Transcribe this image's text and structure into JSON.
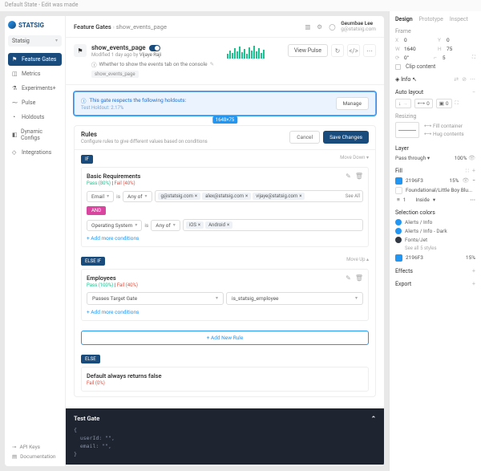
{
  "topBar": "Default State - Edit was made",
  "logo": "STATSIG",
  "workspace": {
    "name": "Statsig"
  },
  "nav": [
    {
      "label": "Feature Gates",
      "active": true
    },
    {
      "label": "Metrics"
    },
    {
      "label": "Experiments+"
    },
    {
      "label": "Pulse"
    },
    {
      "label": "Holdouts"
    },
    {
      "label": "Dynamic Configs"
    },
    {
      "label": "Integrations"
    }
  ],
  "sidebarFooter": {
    "apiKeys": "API Keys",
    "docs": "Documentation"
  },
  "breadcrumb": {
    "root": "Feature Gates",
    "current": "show_events_page"
  },
  "user": {
    "name": "Geumbae Lee",
    "email": "g@statsig.com"
  },
  "page": {
    "title": "show_events_page",
    "modified": "Modified 1 day ago by ",
    "modifiedBy": "Vijaye Raji",
    "desc": "Whether to show the events tab on the console",
    "tag": "show_events_page",
    "viewPulse": "View Pulse"
  },
  "banner": {
    "text": "This gate respects the following holdouts:",
    "sub": "Test Holdout: 2.17%",
    "manage": "Manage",
    "dim": "1648×75"
  },
  "rules": {
    "title": "Rules",
    "sub": "Configure rules to give different values based on conditions",
    "cancel": "Cancel",
    "save": "Save Changes",
    "if": "IF",
    "elseif": "ELSE IF",
    "else": "ELSE",
    "moveDown": "Move Down ▾",
    "moveUp": "Move Up ▴",
    "addCond": "+  Add more conditions",
    "addRule": "+   Add New Rule",
    "rule1": {
      "name": "Basic Requirements",
      "pass": "Pass (80%)",
      "sep": " | ",
      "fail": "Fail (40%)",
      "f1": "Email",
      "op": "Any of",
      "vals": [
        "g@statsig.com",
        "alex@statsig.com",
        "vijaye@statsig.com"
      ],
      "seeAll": "See All",
      "and": "AND",
      "f2": "Operating System",
      "vals2": [
        "iOS",
        "Android"
      ]
    },
    "rule2": {
      "name": "Employees",
      "pass": "Pass (100%)",
      "fail": "Fail (40%)",
      "c1": "Passes Target Gate",
      "c2": "is_statsig_employee"
    },
    "default": {
      "label": "Default always returns false",
      "sub": "Fail (0%)"
    }
  },
  "testGate": {
    "title": "Test Gate",
    "code": "{\n  userId: \"\",\n  email: \"\",\n}"
  },
  "inspector": {
    "tabs": [
      "Design",
      "Prototype",
      "Inspect"
    ],
    "frame": {
      "label": "Frame",
      "x": "0",
      "y": "0",
      "w": "1640",
      "h": "75",
      "rot": "0°",
      "rad": "5",
      "clip": "Clip content"
    },
    "info": {
      "label": "Info"
    },
    "autolayout": {
      "label": "Auto layout",
      "sp1": "0",
      "sp2": "0"
    },
    "resizing": {
      "label": "Resizing",
      "opt1": "Fill container",
      "opt2": "Hug contents"
    },
    "layer": {
      "label": "Layer",
      "pass": "Pass through",
      "pct": "100%"
    },
    "fill": {
      "label": "Fill",
      "color": "2196F3",
      "pct": "15%",
      "lib": "Foundational/Little Boy Blu...",
      "inside": "Inside",
      "stroke": "1"
    },
    "selColors": {
      "label": "Selection colors",
      "items": [
        "Alerts / Info",
        "Alerts / Info - Dark",
        "Fonts/Jet"
      ],
      "seeAll": "See all 5 styles",
      "hex": "2196F3",
      "pct": "15%"
    },
    "effects": "Effects",
    "export": "Export"
  }
}
